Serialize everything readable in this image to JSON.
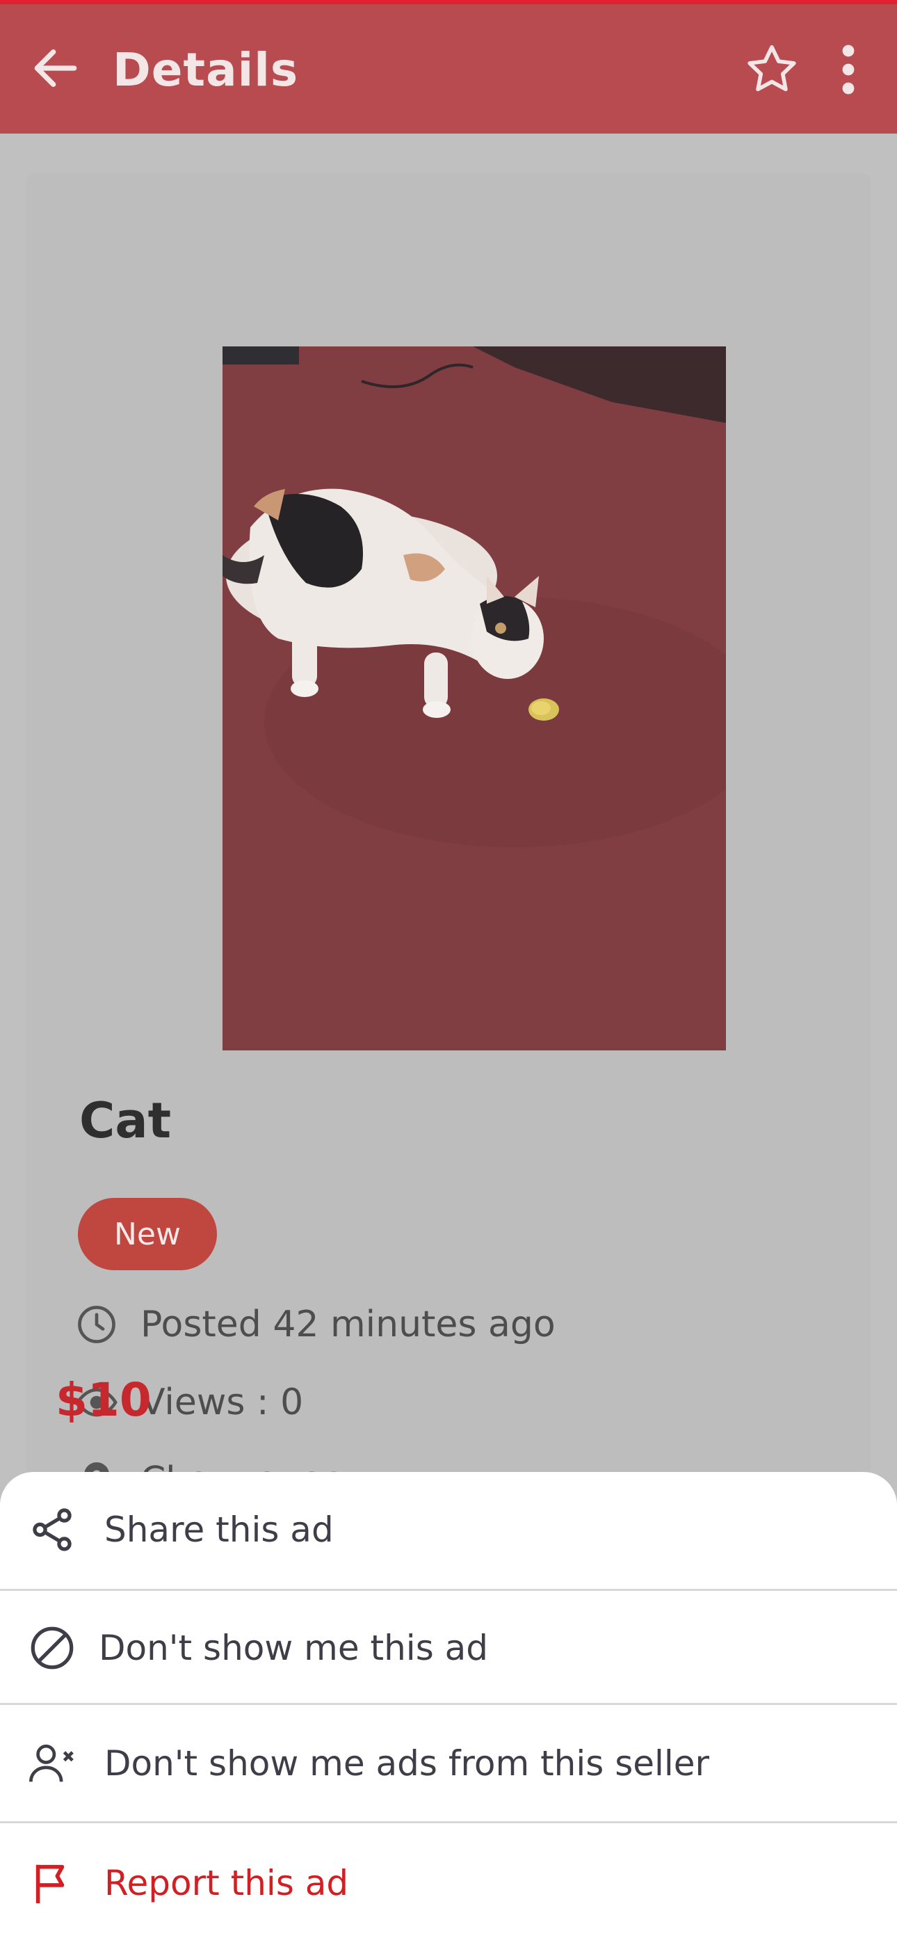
{
  "header": {
    "title": "Details",
    "back_icon": "arrow-left-icon",
    "favorite_icon": "star-icon",
    "more_icon": "more-vertical-icon"
  },
  "ad": {
    "image": "cat-photo",
    "title": "Cat",
    "condition_badge": "New",
    "posted": "Posted 42 minutes ago",
    "views": "Views : 0",
    "location": "Chaguanas",
    "price": "$10"
  },
  "bottom_sheet": {
    "items": [
      {
        "label": "Share this ad",
        "icon": "share-icon"
      },
      {
        "label": "Don't show me this ad",
        "icon": "block-icon"
      },
      {
        "label": "Don't show me ads from this seller",
        "icon": "user-remove-icon"
      },
      {
        "label": "Report this ad",
        "icon": "flag-icon"
      }
    ]
  },
  "colors": {
    "header_bg": "#b84b50",
    "badge_bg": "#c0473f",
    "price": "#c7282d",
    "report": "#d11f24",
    "overlay": "#c0c0c0"
  }
}
